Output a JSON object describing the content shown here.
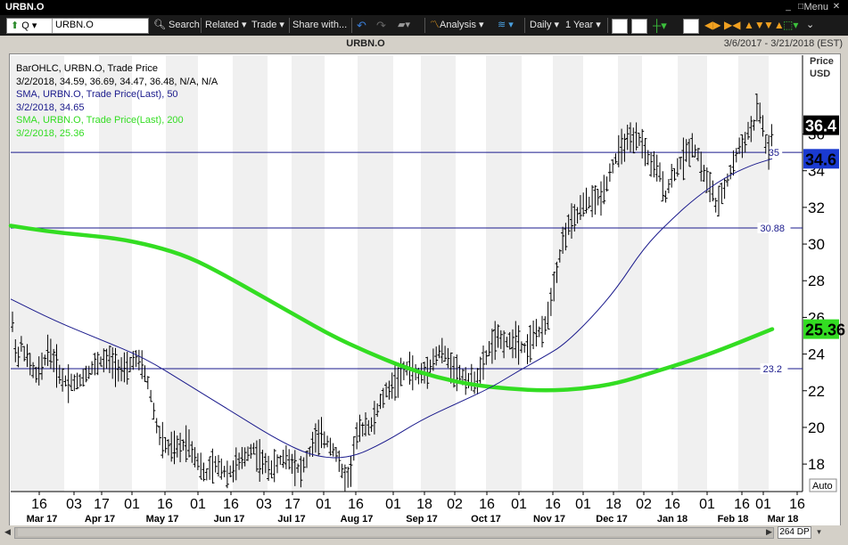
{
  "window": {
    "title": "URBN.O",
    "menu_label": "Menu"
  },
  "toolbar": {
    "symbol_type": "Q",
    "symbol_value": "URBN.O",
    "search_label": "Search",
    "related_label": "Related",
    "trade_label": "Trade",
    "share_label": "Share with...",
    "analysis_label": "Analysis",
    "interval_label": "Daily",
    "range_label": "1 Year"
  },
  "chart_header": {
    "symbol": "URBN.O",
    "date_range": "3/6/2017 - 3/21/2018 (EST)"
  },
  "legend": {
    "line1": "BarOHLC, URBN.O, Trade Price",
    "line2": "3/2/2018, 34.59, 36.69, 34.47, 36.48, N/A, N/A",
    "line3": "SMA, URBN.O, Trade Price(Last),  50",
    "line4": "3/2/2018, 34.65",
    "line5": "SMA, URBN.O, Trade Price(Last),  200",
    "line6": "3/2/2018, 25.36"
  },
  "axis": {
    "price_label_1": "Price",
    "price_label_2": "USD",
    "auto_label": "Auto",
    "dp_label": "264 DP"
  },
  "colors": {
    "background": "#ffffff",
    "band": "#f0f0f0",
    "bars": "#000000",
    "sma50": "#1a1a8c",
    "sma200": "#33dd22",
    "hline": "#1a1a8c"
  },
  "chart_data": {
    "type": "ohlc",
    "title": "URBN.O",
    "y_axis": {
      "min": 16.5,
      "max": 40.3,
      "ticks": [
        18,
        20,
        22,
        24,
        26,
        28,
        30,
        32,
        34,
        36
      ],
      "label": "Price USD",
      "position": "right"
    },
    "x_axis": {
      "day_ticks": [
        "16",
        "03",
        "17",
        "01",
        "16",
        "01",
        "16",
        "03",
        "17",
        "01",
        "16",
        "01",
        "18",
        "02",
        "16",
        "01",
        "16",
        "01",
        "18",
        "02",
        "16",
        "01",
        "16",
        "01",
        "16"
      ],
      "month_labels": [
        "Mar 17",
        "Apr 17",
        "May 17",
        "Jun 17",
        "Jul 17",
        "Aug 17",
        "Sep 17",
        "Oct 17",
        "Nov 17",
        "Dec 17",
        "Jan 18",
        "Feb 18",
        "Mar 18"
      ]
    },
    "horizontal_lines": [
      {
        "value": 35,
        "label": "35"
      },
      {
        "value": 30.88,
        "label": "30.88"
      },
      {
        "value": 23.2,
        "label": "23.2"
      }
    ],
    "price_badges": [
      {
        "value": 36.48,
        "label": "36.4",
        "style": "last"
      },
      {
        "value": 34.65,
        "label": "34.6",
        "style": "sma50"
      },
      {
        "value": 25.36,
        "label": "25.36",
        "style": "sma200"
      }
    ],
    "price_path": [
      [
        0,
        26.0
      ],
      [
        3,
        25.5
      ],
      [
        7,
        23.5
      ],
      [
        12,
        24.5
      ],
      [
        20,
        23.6
      ],
      [
        28,
        22.8
      ],
      [
        35,
        23.2
      ],
      [
        42,
        24.3
      ],
      [
        50,
        23.5
      ],
      [
        58,
        22.6
      ],
      [
        66,
        22.5
      ],
      [
        74,
        22.4
      ],
      [
        82,
        22.8
      ],
      [
        90,
        23.2
      ],
      [
        100,
        23.6
      ],
      [
        110,
        23.7
      ],
      [
        120,
        23.3
      ],
      [
        130,
        23.0
      ],
      [
        138,
        23.8
      ],
      [
        145,
        23.5
      ],
      [
        152,
        22.8
      ],
      [
        158,
        21.5
      ],
      [
        164,
        20.0
      ],
      [
        170,
        19.2
      ],
      [
        176,
        18.9
      ],
      [
        182,
        18.8
      ],
      [
        190,
        18.9
      ],
      [
        198,
        19.3
      ],
      [
        205,
        18.6
      ],
      [
        212,
        18.0
      ],
      [
        218,
        17.3
      ],
      [
        224,
        17.8
      ],
      [
        230,
        17.9
      ],
      [
        236,
        17.8
      ],
      [
        242,
        17.5
      ],
      [
        248,
        17.6
      ],
      [
        254,
        18.0
      ],
      [
        260,
        18.2
      ],
      [
        266,
        18.6
      ],
      [
        272,
        18.9
      ],
      [
        278,
        18.3
      ],
      [
        284,
        18.0
      ],
      [
        290,
        17.8
      ],
      [
        296,
        17.8
      ],
      [
        302,
        18.2
      ],
      [
        310,
        18.4
      ],
      [
        318,
        18.0
      ],
      [
        326,
        17.6
      ],
      [
        334,
        18.5
      ],
      [
        340,
        19.3
      ],
      [
        348,
        19.5
      ],
      [
        356,
        19.2
      ],
      [
        364,
        18.7
      ],
      [
        372,
        17.5
      ],
      [
        380,
        17.2
      ],
      [
        386,
        19.3
      ],
      [
        392,
        19.8
      ],
      [
        398,
        20.2
      ],
      [
        404,
        20.0
      ],
      [
        410,
        20.8
      ],
      [
        416,
        21.5
      ],
      [
        422,
        22.0
      ],
      [
        428,
        22.3
      ],
      [
        434,
        22.6
      ],
      [
        440,
        23.0
      ],
      [
        446,
        23.3
      ],
      [
        452,
        23.0
      ],
      [
        458,
        22.8
      ],
      [
        464,
        23.0
      ],
      [
        470,
        23.4
      ],
      [
        476,
        23.8
      ],
      [
        482,
        24.2
      ],
      [
        488,
        23.9
      ],
      [
        494,
        23.4
      ],
      [
        500,
        23.0
      ],
      [
        506,
        22.8
      ],
      [
        512,
        22.6
      ],
      [
        518,
        22.5
      ],
      [
        524,
        22.7
      ],
      [
        530,
        23.4
      ],
      [
        536,
        24.2
      ],
      [
        542,
        24.7
      ],
      [
        548,
        24.8
      ],
      [
        554,
        24.7
      ],
      [
        560,
        24.6
      ],
      [
        566,
        24.9
      ],
      [
        572,
        24.5
      ],
      [
        578,
        24.3
      ],
      [
        584,
        24.7
      ],
      [
        590,
        25.3
      ],
      [
        596,
        25.0
      ],
      [
        602,
        26.0
      ],
      [
        608,
        27.5
      ],
      [
        614,
        29.0
      ],
      [
        620,
        30.3
      ],
      [
        626,
        31.0
      ],
      [
        632,
        31.3
      ],
      [
        638,
        31.8
      ],
      [
        644,
        32.2
      ],
      [
        650,
        32.3
      ],
      [
        656,
        32.4
      ],
      [
        662,
        32.6
      ],
      [
        668,
        33.3
      ],
      [
        674,
        34.2
      ],
      [
        680,
        34.8
      ],
      [
        686,
        35.3
      ],
      [
        692,
        35.7
      ],
      [
        698,
        35.5
      ],
      [
        704,
        35.8
      ],
      [
        710,
        35.3
      ],
      [
        716,
        34.5
      ],
      [
        722,
        34.2
      ],
      [
        728,
        33.8
      ],
      [
        734,
        32.6
      ],
      [
        740,
        33.5
      ],
      [
        746,
        34.0
      ],
      [
        752,
        34.5
      ],
      [
        758,
        35.0
      ],
      [
        764,
        35.4
      ],
      [
        770,
        35.0
      ],
      [
        776,
        34.0
      ],
      [
        782,
        33.3
      ],
      [
        788,
        32.8
      ],
      [
        792,
        31.8
      ],
      [
        798,
        32.8
      ],
      [
        804,
        33.5
      ],
      [
        810,
        34.3
      ],
      [
        816,
        35.2
      ],
      [
        822,
        35.5
      ],
      [
        828,
        36.2
      ],
      [
        834,
        36.5
      ],
      [
        838,
        37.6
      ],
      [
        842,
        36.8
      ],
      [
        846,
        35.6
      ],
      [
        850,
        35.0
      ],
      [
        854,
        36.0
      ]
    ],
    "sma50_path": [
      [
        0,
        27.0
      ],
      [
        50,
        25.8
      ],
      [
        100,
        24.8
      ],
      [
        150,
        23.8
      ],
      [
        200,
        22.3
      ],
      [
        250,
        20.8
      ],
      [
        300,
        19.3
      ],
      [
        340,
        18.4
      ],
      [
        380,
        18.3
      ],
      [
        420,
        19.2
      ],
      [
        460,
        20.4
      ],
      [
        500,
        21.3
      ],
      [
        540,
        22.2
      ],
      [
        570,
        23.1
      ],
      [
        600,
        23.9
      ],
      [
        620,
        24.5
      ],
      [
        650,
        25.9
      ],
      [
        680,
        27.6
      ],
      [
        710,
        29.8
      ],
      [
        740,
        31.3
      ],
      [
        770,
        32.6
      ],
      [
        800,
        33.6
      ],
      [
        830,
        34.3
      ],
      [
        854,
        34.65
      ]
    ],
    "sma200_path": [
      [
        0,
        31.0
      ],
      [
        40,
        30.7
      ],
      [
        80,
        30.5
      ],
      [
        120,
        30.3
      ],
      [
        160,
        29.9
      ],
      [
        200,
        29.3
      ],
      [
        240,
        28.3
      ],
      [
        280,
        27.2
      ],
      [
        320,
        26.1
      ],
      [
        360,
        25.0
      ],
      [
        400,
        24.1
      ],
      [
        440,
        23.3
      ],
      [
        480,
        22.7
      ],
      [
        520,
        22.3
      ],
      [
        560,
        22.1
      ],
      [
        600,
        22.0
      ],
      [
        640,
        22.1
      ],
      [
        680,
        22.4
      ],
      [
        720,
        23.0
      ],
      [
        760,
        23.6
      ],
      [
        800,
        24.3
      ],
      [
        854,
        25.36
      ]
    ]
  }
}
